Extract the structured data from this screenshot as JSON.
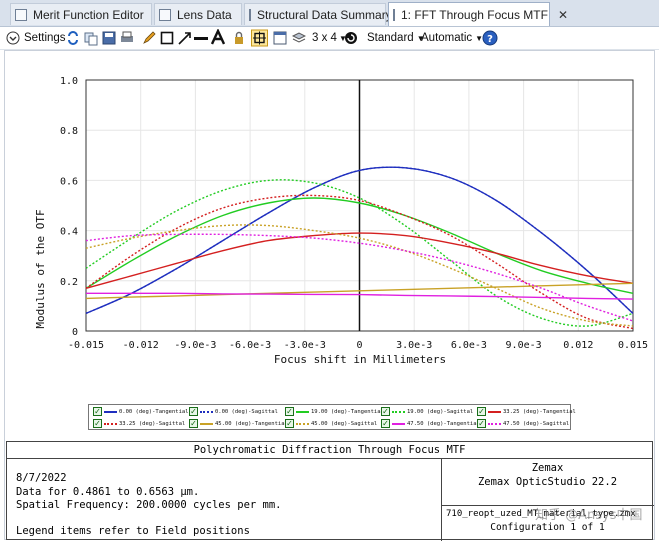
{
  "tabs": [
    {
      "label": "Merit Function Editor",
      "icon": "merit-function-icon",
      "active": false
    },
    {
      "label": "Lens Data",
      "icon": "lens-data-icon",
      "active": false
    },
    {
      "label": "Structural Data Summary",
      "icon": "structural-data-icon",
      "active": false
    },
    {
      "label": "1: FFT Through Focus MTF",
      "icon": "mtf-icon",
      "active": true,
      "close": "✕"
    }
  ],
  "toolbar": {
    "settings_label": "Settings",
    "layout_label": "3 x 4",
    "standard_label": "Standard",
    "automatic_label": "Automatic"
  },
  "chart_data": {
    "type": "line",
    "xlabel": "Focus shift in Millimeters",
    "ylabel": "Modulus of the OTF",
    "xlim": [
      -0.015,
      0.015
    ],
    "ylim": [
      0,
      1.0
    ],
    "x_tick_labels": [
      "-0.015",
      "-0.012",
      "-9.0e-3",
      "-6.0e-3",
      "-3.0e-3",
      "0",
      "3.0e-3",
      "6.0e-3",
      "9.0e-3",
      "0.012",
      "0.015"
    ],
    "y_tick_labels": [
      "0",
      "0.2",
      "0.4",
      "0.6",
      "0.8",
      "1.0"
    ],
    "grid": true,
    "x": [
      -0.015,
      -0.0125,
      -0.01,
      -0.0075,
      -0.005,
      -0.0025,
      0,
      0.0025,
      0.005,
      0.0075,
      0.01,
      0.0125,
      0.015
    ],
    "series": [
      {
        "name": "0.00 (deg)-Tangential",
        "color": "#1f2fbf",
        "dash": false,
        "values": [
          0.07,
          0.15,
          0.25,
          0.36,
          0.47,
          0.57,
          0.64,
          0.65,
          0.61,
          0.52,
          0.39,
          0.24,
          0.07
        ]
      },
      {
        "name": "0.00 (deg)-Sagittal",
        "color": "#1f2fbf",
        "dash": true,
        "values": [
          0.07,
          0.15,
          0.25,
          0.36,
          0.47,
          0.57,
          0.64,
          0.65,
          0.61,
          0.52,
          0.39,
          0.24,
          0.07
        ]
      },
      {
        "name": "19.00 (deg)-Tangential",
        "color": "#22cc22",
        "dash": false,
        "values": [
          0.17,
          0.28,
          0.38,
          0.46,
          0.51,
          0.53,
          0.51,
          0.46,
          0.39,
          0.31,
          0.24,
          0.19,
          0.15
        ]
      },
      {
        "name": "19.00 (deg)-Sagittal",
        "color": "#22cc22",
        "dash": true,
        "values": [
          0.25,
          0.37,
          0.48,
          0.56,
          0.6,
          0.59,
          0.53,
          0.42,
          0.28,
          0.14,
          0.05,
          0.02,
          0.07
        ]
      },
      {
        "name": "33.25 (deg)-Tangential",
        "color": "#d42020",
        "dash": false,
        "values": [
          0.17,
          0.22,
          0.27,
          0.32,
          0.36,
          0.38,
          0.39,
          0.38,
          0.35,
          0.31,
          0.26,
          0.22,
          0.19
        ]
      },
      {
        "name": "33.25 (deg)-Sagittal",
        "color": "#d42020",
        "dash": true,
        "values": [
          0.17,
          0.3,
          0.41,
          0.49,
          0.53,
          0.54,
          0.52,
          0.46,
          0.38,
          0.27,
          0.15,
          0.05,
          0.01
        ]
      },
      {
        "name": "45.00 (deg)-Tangential",
        "color": "#c9a227",
        "dash": false,
        "values": [
          0.13,
          0.135,
          0.14,
          0.145,
          0.15,
          0.155,
          0.16,
          0.165,
          0.17,
          0.175,
          0.18,
          0.185,
          0.19
        ]
      },
      {
        "name": "45.00 (deg)-Sagittal",
        "color": "#c9a227",
        "dash": true,
        "values": [
          0.33,
          0.37,
          0.4,
          0.42,
          0.42,
          0.4,
          0.37,
          0.32,
          0.25,
          0.17,
          0.09,
          0.04,
          0.02
        ]
      },
      {
        "name": "47.50 (deg)-Tangential",
        "color": "#e020e0",
        "dash": false,
        "values": [
          0.15,
          0.15,
          0.15,
          0.148,
          0.147,
          0.146,
          0.145,
          0.142,
          0.14,
          0.137,
          0.134,
          0.13,
          0.127
        ]
      },
      {
        "name": "47.50 (deg)-Sagittal",
        "color": "#e020e0",
        "dash": true,
        "values": [
          0.36,
          0.38,
          0.385,
          0.385,
          0.38,
          0.37,
          0.35,
          0.32,
          0.28,
          0.23,
          0.17,
          0.1,
          0.04
        ]
      }
    ]
  },
  "legend_labels": [
    "0.00 (deg)-Tangential",
    "0.00 (deg)-Sagittal",
    "19.00 (deg)-Tangential",
    "19.00 (deg)-Sagittal",
    "33.25 (deg)-Tangential",
    "33.25 (deg)-Sagittal",
    "45.00 (deg)-Tangential",
    "45.00 (deg)-Sagittal",
    "47.50 (deg)-Tangential",
    "47.50 (deg)-Sagittal"
  ],
  "info": {
    "title": "Polychromatic Diffraction Through Focus MTF",
    "date": "8/7/2022",
    "line1": "Data for 0.4861 to 0.6563 µm.",
    "line2": "Spatial Frequency: 200.0000 cycles per mm.",
    "line3": "Legend items refer to Field positions",
    "company": "Zemax",
    "product": "Zemax OpticStudio 22.2",
    "file": "710_reopt_uzed_MT_material_type.zmx",
    "config": "Configuration 1 of 1",
    "watermark": "知乎 @Ansys中国"
  }
}
